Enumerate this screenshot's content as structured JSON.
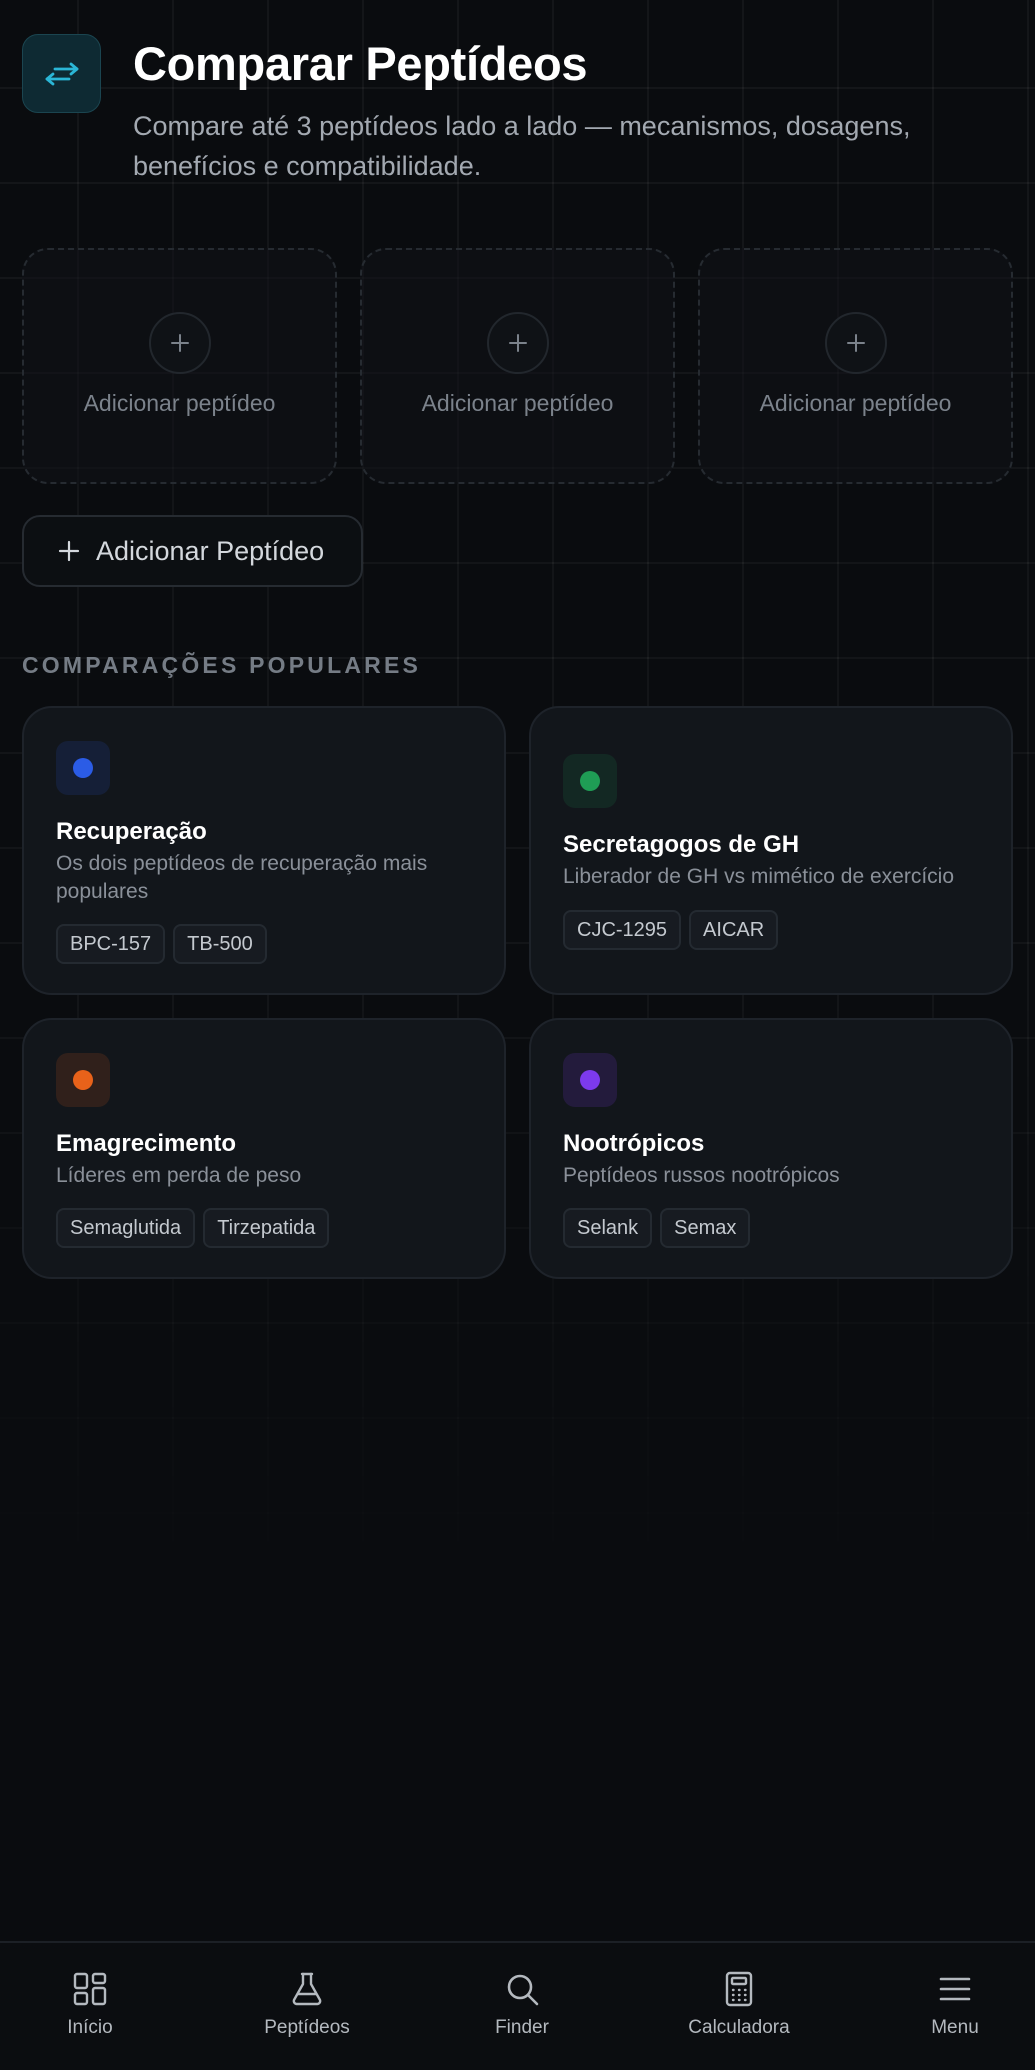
{
  "header": {
    "icon": "arrows-swap-icon",
    "title": "Comparar Peptídeos",
    "subtitle": "Compare até 3 peptídeos lado a lado — mecanismos, dosagens, benefícios e compatibilidade."
  },
  "slots": [
    {
      "label": "Adicionar peptídeo",
      "icon": "plus-icon"
    },
    {
      "label": "Adicionar peptídeo",
      "icon": "plus-icon"
    },
    {
      "label": "Adicionar peptídeo",
      "icon": "plus-icon"
    }
  ],
  "add_button": {
    "label": "Adicionar Peptídeo",
    "icon": "plus-icon"
  },
  "popular": {
    "section_title": "COMPARAÇÕES POPULARES",
    "cards": [
      {
        "title": "Recuperação",
        "description": "Os dois peptídeos de recuperação mais populares",
        "color": "#2b5ce6",
        "tags": [
          "BPC-157",
          "TB-500"
        ]
      },
      {
        "title": "Secretagogos de GH",
        "description": "Liberador de GH vs mimético de exercício",
        "color": "#1f9d55",
        "tags": [
          "CJC-1295",
          "AICAR"
        ]
      },
      {
        "title": "Emagrecimento",
        "description": "Líderes em perda de peso",
        "color": "#e8621a",
        "tags": [
          "Semaglutida",
          "Tirzepatida"
        ]
      },
      {
        "title": "Nootrópicos",
        "description": "Peptídeos russos nootrópicos",
        "color": "#7c3aed",
        "tags": [
          "Selank",
          "Semax"
        ]
      }
    ]
  },
  "nav": {
    "items": [
      {
        "label": "Início",
        "icon": "grid-icon"
      },
      {
        "label": "Peptídeos",
        "icon": "flask-icon"
      },
      {
        "label": "Finder",
        "icon": "search-icon"
      },
      {
        "label": "Calculadora",
        "icon": "calculator-icon"
      },
      {
        "label": "Menu",
        "icon": "menu-icon"
      }
    ]
  }
}
